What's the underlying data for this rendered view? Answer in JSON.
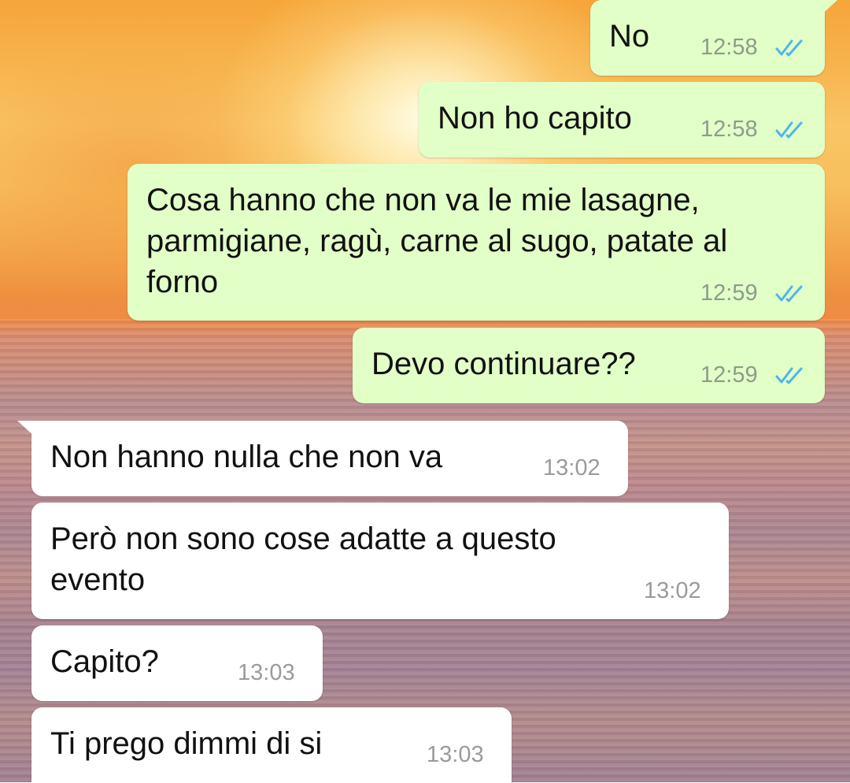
{
  "colors": {
    "outgoing_bubble": "#e2ffc7",
    "incoming_bubble": "#ffffff",
    "read_ticks": "#4fb5ec"
  },
  "messages": [
    {
      "direction": "outgoing",
      "text": "No",
      "time": "12:58",
      "status": "read",
      "status_icon": "double-check-icon"
    },
    {
      "direction": "outgoing",
      "text": "Non ho capito",
      "time": "12:58",
      "status": "read",
      "status_icon": "double-check-icon"
    },
    {
      "direction": "outgoing",
      "lines": [
        "Cosa hanno che non va le mie lasagne,",
        "parmigiane, ragù, carne al sugo, patate al",
        "forno"
      ],
      "time": "12:59",
      "status": "read",
      "status_icon": "double-check-icon"
    },
    {
      "direction": "outgoing",
      "text": "Devo continuare??",
      "time": "12:59",
      "status": "read",
      "status_icon": "double-check-icon"
    },
    {
      "direction": "incoming",
      "text": "Non hanno nulla che non va",
      "time": "13:02"
    },
    {
      "direction": "incoming",
      "lines": [
        "Però non sono cose adatte a questo",
        "evento"
      ],
      "time": "13:02"
    },
    {
      "direction": "incoming",
      "text": "Capito?",
      "time": "13:03"
    },
    {
      "direction": "incoming",
      "text": "Ti prego dimmi di si",
      "time": "13:03"
    }
  ]
}
